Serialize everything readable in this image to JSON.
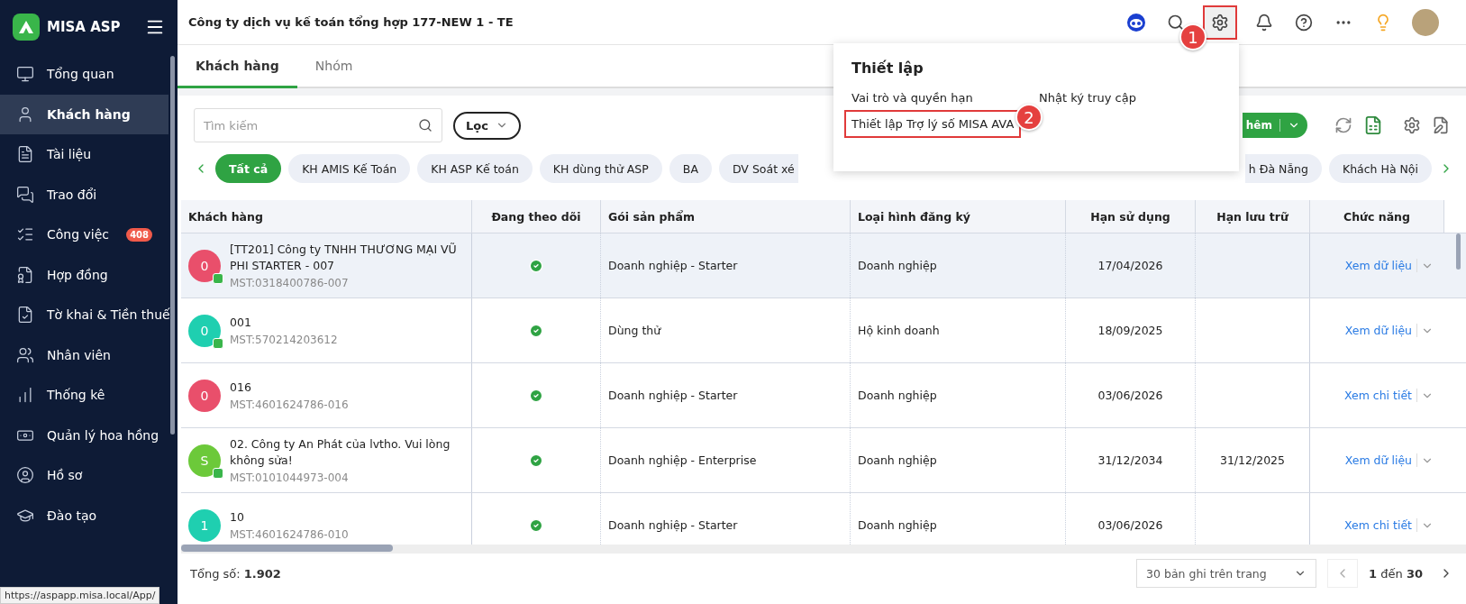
{
  "app": {
    "logo_text": "MISA ASP"
  },
  "sidebar": {
    "items": [
      {
        "label": "Tổng quan",
        "selected": false
      },
      {
        "label": "Khách hàng",
        "selected": true
      },
      {
        "label": "Tài liệu",
        "selected": false
      },
      {
        "label": "Trao đổi",
        "selected": false
      },
      {
        "label": "Công việc",
        "selected": false,
        "badge": "408"
      },
      {
        "label": "Hợp đồng",
        "selected": false
      },
      {
        "label": "Tờ khai & Tiền thuế",
        "selected": false
      },
      {
        "label": "Nhân viên",
        "selected": false
      },
      {
        "label": "Thống kê",
        "selected": false
      },
      {
        "label": "Quản lý hoa hồng",
        "selected": false
      },
      {
        "label": "Hồ sơ",
        "selected": false
      },
      {
        "label": "Đào tạo",
        "selected": false
      }
    ],
    "link_preview": "https://aspapp.misa.local/App/"
  },
  "header": {
    "company": "Công ty dịch vụ kế toán tổng hợp 177-NEW 1 - TE"
  },
  "annotations": [
    {
      "label": "1"
    },
    {
      "label": "2"
    }
  ],
  "tabs": [
    {
      "label": "Khách hàng",
      "selected": true
    },
    {
      "label": "Nhóm",
      "selected": false
    }
  ],
  "search": {
    "placeholder": "Tìm kiếm"
  },
  "filter": {
    "label": "Lọc"
  },
  "add_button": {
    "label": "hêm"
  },
  "chips": [
    {
      "label": "Tất cả",
      "selected": true,
      "kind": "whole"
    },
    {
      "label": "KH AMIS Kế Toán",
      "selected": false,
      "kind": "whole"
    },
    {
      "label": "KH ASP Kế toán",
      "selected": false,
      "kind": "whole"
    },
    {
      "label": "KH dùng thử ASP",
      "selected": false,
      "kind": "whole"
    },
    {
      "label": "BA",
      "selected": false,
      "kind": "whole"
    },
    {
      "label": "DV Soát xé",
      "selected": false,
      "kind": "cut-end"
    },
    {
      "label": "h Đà Nẵng",
      "selected": false,
      "kind": "cut-start"
    },
    {
      "label": "Khách Hà Nội",
      "selected": false,
      "kind": "whole"
    }
  ],
  "settings_menu": {
    "title": "Thiết lập",
    "items": [
      {
        "label": "Vai trò và quyền hạn",
        "highlighted": false
      },
      {
        "label": "Nhật ký truy cập",
        "highlighted": false
      },
      {
        "label": "Thiết lập Trợ lý số MISA AVA",
        "highlighted": true
      }
    ]
  },
  "table": {
    "columns": [
      "Khách hàng",
      "Đang theo dõi",
      "Gói sản phẩm",
      "Loại hình đăng ký",
      "Hạn sử dụng",
      "Hạn lưu trữ",
      "Chức năng"
    ],
    "rows": [
      {
        "selected": true,
        "avatar": "0",
        "color": "#e94f6b",
        "badge": true,
        "name": "[TT201] Công ty TNHH THƯƠNG MẠI VŨ PHI STARTER - 007",
        "tax_id": "MST:0318400786-007",
        "following": true,
        "package": "Doanh nghiệp - Starter",
        "type": "Doanh nghiệp",
        "expiry": "17/04/2026",
        "storage": "",
        "action": "Xem dữ liệu"
      },
      {
        "selected": false,
        "avatar": "0",
        "color": "#1fcfb0",
        "badge": true,
        "name": "001",
        "tax_id": "MST:570214203612",
        "following": true,
        "package": "Dùng thử",
        "type": "Hộ kinh doanh",
        "expiry": "18/09/2025",
        "storage": "",
        "action": "Xem dữ liệu"
      },
      {
        "selected": false,
        "avatar": "0",
        "color": "#e94f6b",
        "badge": false,
        "name": "016",
        "tax_id": "MST:4601624786-016",
        "following": true,
        "package": "Doanh nghiệp - Starter",
        "type": "Doanh nghiệp",
        "expiry": "03/06/2026",
        "storage": "",
        "action": "Xem chi tiết"
      },
      {
        "selected": false,
        "avatar": "S",
        "color": "#6cc93a",
        "badge": true,
        "name": "02. Công ty An Phát của lvtho. Vui lòng không sửa!",
        "tax_id": "MST:0101044973-004",
        "following": true,
        "package": "Doanh nghiệp - Enterprise",
        "type": "Doanh nghiệp",
        "expiry": "31/12/2034",
        "storage": "31/12/2025",
        "action": "Xem dữ liệu"
      },
      {
        "selected": false,
        "avatar": "1",
        "color": "#1fcfb0",
        "badge": false,
        "name": "10",
        "tax_id": "MST:4601624786-010",
        "following": true,
        "package": "Doanh nghiệp - Starter",
        "type": "Doanh nghiệp",
        "expiry": "03/06/2026",
        "storage": "",
        "action": "Xem chi tiết"
      }
    ]
  },
  "footer": {
    "total": "Tổng số: **1.902**",
    "page_size": "30 bản ghi trên trang",
    "range": "**1** đến **30**"
  }
}
